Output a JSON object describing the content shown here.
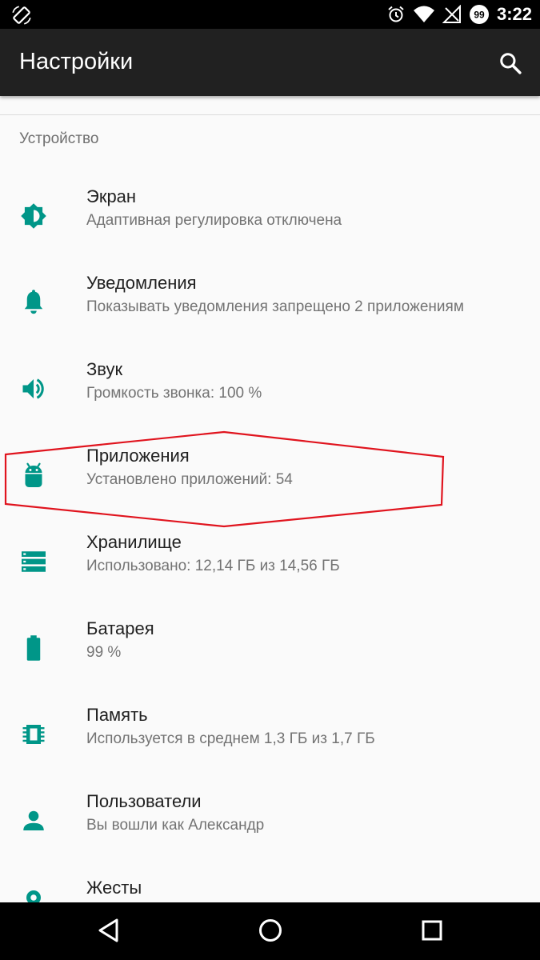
{
  "status_bar": {
    "time": "3:22",
    "notification_badge": "99",
    "icons": [
      "screen-rotation-icon",
      "alarm-icon",
      "wifi-icon",
      "no-signal-icon",
      "notification-count-icon"
    ]
  },
  "app_bar": {
    "title": "Настройки",
    "search_icon": "search-icon"
  },
  "section": {
    "header": "Устройство"
  },
  "items": [
    {
      "title": "Экран",
      "summary": "Адаптивная регулировка отключена",
      "icon": "brightness-icon"
    },
    {
      "title": "Уведомления",
      "summary": "Показывать уведомления запрещено 2 приложениям",
      "icon": "bell-icon"
    },
    {
      "title": "Звук",
      "summary": "Громкость звонка: 100 %",
      "icon": "volume-icon"
    },
    {
      "title": "Приложения",
      "summary": "Установлено приложений: 54",
      "icon": "android-icon"
    },
    {
      "title": "Хранилище",
      "summary": "Использовано: 12,14 ГБ из 14,56 ГБ",
      "icon": "storage-icon"
    },
    {
      "title": "Батарея",
      "summary": "99 %",
      "icon": "battery-icon"
    },
    {
      "title": "Память",
      "summary": "Используется в среднем 1,3 ГБ из 1,7 ГБ",
      "icon": "memory-chip-icon"
    },
    {
      "title": "Пользователи",
      "summary": "Вы вошли как Александр",
      "icon": "person-icon"
    },
    {
      "title": "Жесты",
      "summary": "",
      "icon": "gestures-icon"
    }
  ],
  "nav_bar": {
    "icons": [
      "back-icon",
      "home-icon",
      "recents-icon"
    ]
  },
  "colors": {
    "accent": "#009688",
    "app_bar": "#212121",
    "status_bar": "#000000",
    "highlight": "#e0141e"
  }
}
